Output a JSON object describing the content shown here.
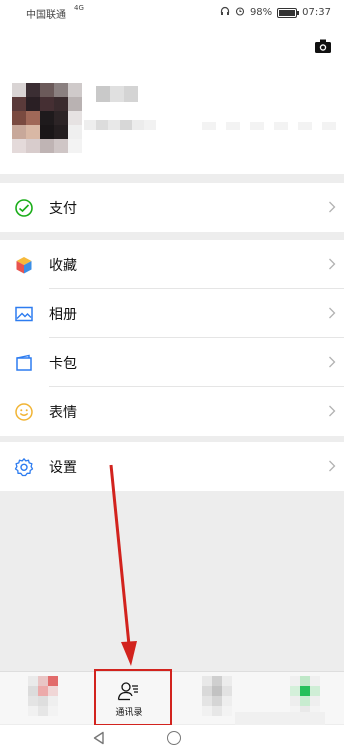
{
  "status_bar": {
    "carrier": "中国联通",
    "signal": "4G",
    "battery": "98%",
    "battery_level": 0.98,
    "time": "07:37"
  },
  "profile": {
    "camera_icon": "camera-icon"
  },
  "menu": {
    "pay": {
      "label": "支付",
      "icon": "wallet-check-icon",
      "color": "#1aad19"
    },
    "favorites": {
      "label": "收藏",
      "icon": "cube-icon"
    },
    "album": {
      "label": "相册",
      "icon": "picture-icon",
      "color": "#2d7cf0"
    },
    "cards": {
      "label": "卡包",
      "icon": "card-wallet-icon",
      "color": "#2d7cf0"
    },
    "stickers": {
      "label": "表情",
      "icon": "smiley-icon",
      "color": "#f1b434"
    },
    "settings": {
      "label": "设置",
      "icon": "gear-icon",
      "color": "#2d7cf0"
    }
  },
  "tabbar": {
    "contacts_label": "通讯录",
    "contacts_icon": "contacts-icon"
  },
  "annotation": {
    "color": "#d2231e"
  },
  "nav": {
    "back_icon": "back-triangle-icon",
    "home_icon": "home-circle-icon"
  }
}
